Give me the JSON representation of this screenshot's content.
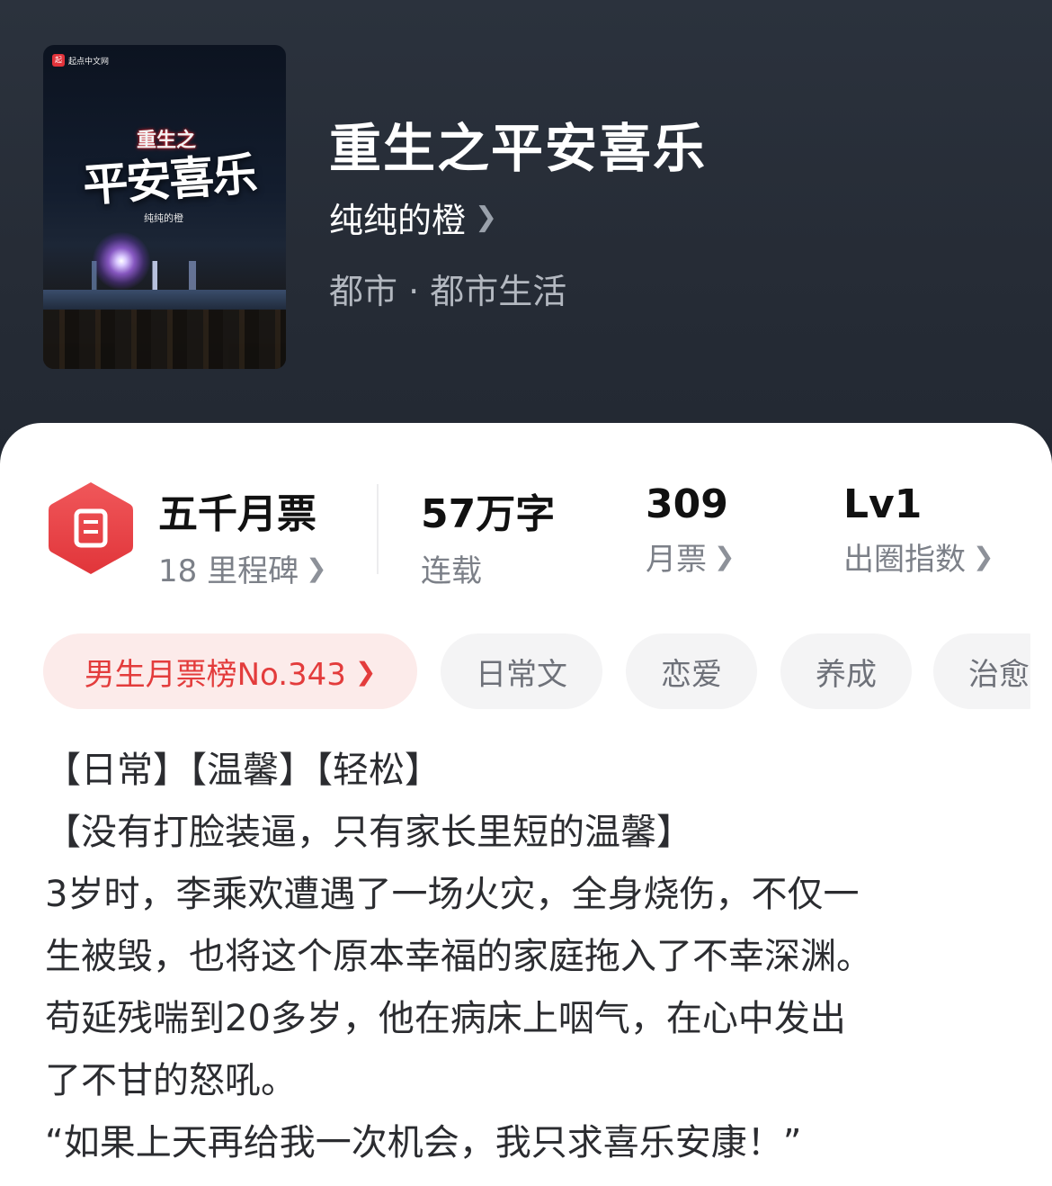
{
  "header": {
    "cover": {
      "publisher": "起点中文网",
      "title_small": "重生之",
      "title_large": "平安喜乐",
      "author": "纯纯的橙"
    },
    "title": "重生之平安喜乐",
    "author": "纯纯的橙",
    "category": "都市 · 都市生活"
  },
  "stats": {
    "badge": {
      "title": "五千月票",
      "subtitle": "18 里程碑"
    },
    "words": {
      "value": "57万字",
      "label": "连载"
    },
    "votes": {
      "value": "309",
      "label": "月票"
    },
    "influence": {
      "value": "Lv1",
      "label": "出圈指数"
    }
  },
  "tags": [
    "男生月票榜No.343",
    "日常文",
    "恋爱",
    "养成",
    "治愈"
  ],
  "description": [
    "【日常】【温馨】【轻松】",
    "【没有打脸装逼，只有家长里短的温馨】",
    "3岁时，李乘欢遭遇了一场火灾，全身烧伤，不仅一",
    "生被毁，也将这个原本幸福的家庭拖入了不幸深渊。",
    "苟延残喘到20多岁，他在病床上咽气，在心中发出",
    "了不甘的怒吼。",
    "“如果上天再给我一次机会，我只求喜乐安康！”"
  ],
  "colors": {
    "hero_bg": "#262c36",
    "accent_red": "#e33c3c",
    "rank_tag_bg": "#fcebea"
  }
}
